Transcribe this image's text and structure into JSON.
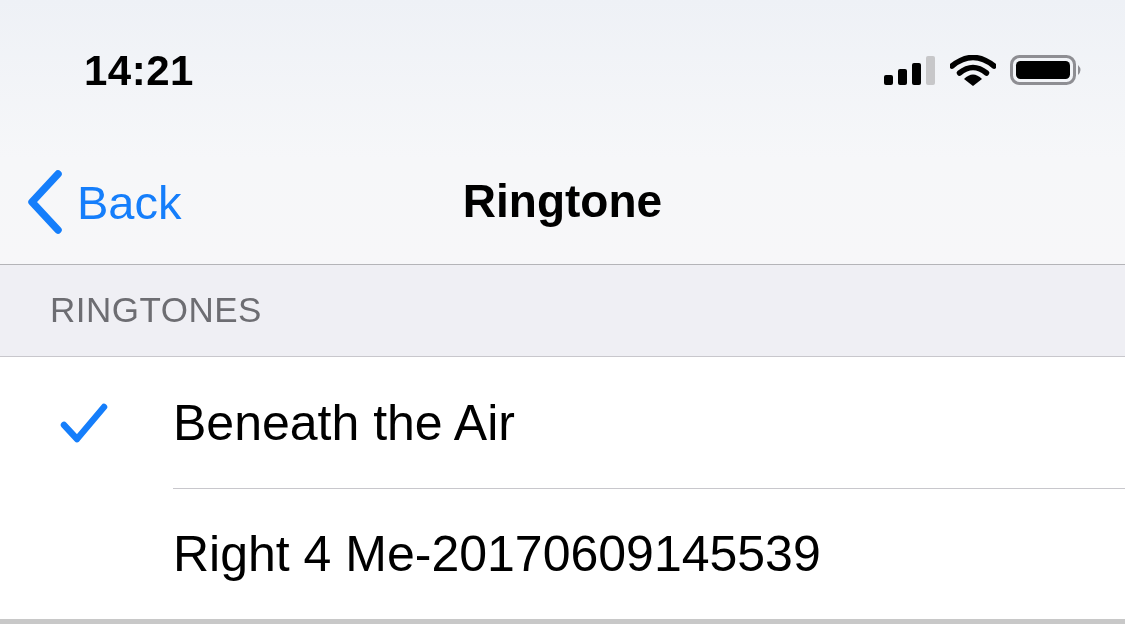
{
  "status_bar": {
    "time": "14:21"
  },
  "nav_bar": {
    "back": "Back",
    "title": "Ringtone"
  },
  "section": {
    "header": "RINGTONES",
    "items": [
      {
        "label": "Beneath the Air",
        "selected": true
      },
      {
        "label": "Right 4 Me-20170609145539",
        "selected": false
      }
    ]
  }
}
